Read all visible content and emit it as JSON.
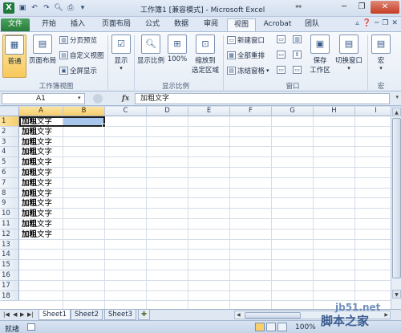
{
  "window": {
    "title": "工作簿1 [兼容模式] - Microsoft Excel",
    "app_icon_letter": "X",
    "qat_icons": [
      "save-icon",
      "undo-icon",
      "redo-icon",
      "print-preview-icon",
      "printer-icon",
      "customize-qat-icon"
    ],
    "resize_glyph": "⇔"
  },
  "tabs": [
    {
      "label": "文件",
      "id": "file"
    },
    {
      "label": "开始",
      "id": "home"
    },
    {
      "label": "插入",
      "id": "insert"
    },
    {
      "label": "页面布局",
      "id": "page-layout"
    },
    {
      "label": "公式",
      "id": "formulas"
    },
    {
      "label": "数据",
      "id": "data"
    },
    {
      "label": "审阅",
      "id": "review"
    },
    {
      "label": "视图",
      "id": "view",
      "active": true
    },
    {
      "label": "Acrobat",
      "id": "acrobat"
    },
    {
      "label": "团队",
      "id": "team"
    }
  ],
  "ribbon": {
    "workbook_views": {
      "label": "工作簿视图",
      "normal": "普通",
      "page_layout": "页面布局",
      "page_break_preview": "分页预览",
      "custom_views": "自定义视图",
      "full_screen": "全屏显示"
    },
    "show": {
      "label": "显示"
    },
    "zoom": {
      "label": "显示比例",
      "zoom": "显示比例",
      "hundred": "100%",
      "zoom_selection_1": "缩放到",
      "zoom_selection_2": "选定区域"
    },
    "window": {
      "label": "窗口",
      "new_window": "新建窗口",
      "arrange_all": "全部重排",
      "freeze_panes": "冻结窗格",
      "save_workspace_1": "保存",
      "save_workspace_2": "工作区",
      "switch_windows": "切换窗口"
    },
    "macros": {
      "label": "宏",
      "macros": "宏"
    }
  },
  "formula_bar": {
    "name_box": "A1",
    "fx": "fx",
    "content": "加粗文字"
  },
  "sheet": {
    "columns": [
      "A",
      "B",
      "C",
      "D",
      "E",
      "F",
      "G",
      "H",
      "I"
    ],
    "selected_columns": [
      "A",
      "B"
    ],
    "rows": [
      "1",
      "2",
      "3",
      "4",
      "5",
      "6",
      "7",
      "8",
      "9",
      "10",
      "11",
      "12",
      "13",
      "14",
      "15",
      "16",
      "17",
      "18"
    ],
    "selected_rows": [
      "1"
    ],
    "cells_a": [
      {
        "bold": "加粗",
        "plain": "文字"
      },
      {
        "bold": "加粗",
        "plain": "文字"
      },
      {
        "bold": "加粗",
        "plain": "文字"
      },
      {
        "bold": "加粗",
        "plain": "文字"
      },
      {
        "bold": "加粗",
        "plain": "文字"
      },
      {
        "bold": "加粗",
        "plain": "文字"
      },
      {
        "bold": "加粗",
        "plain": "文字"
      },
      {
        "bold": "加粗",
        "plain": "文字"
      },
      {
        "bold": "加粗",
        "plain": "文字"
      },
      {
        "bold": "加粗",
        "plain": "文字"
      },
      {
        "bold": "加粗",
        "plain": "文字"
      },
      {
        "bold": "加粗",
        "plain": "文字"
      }
    ],
    "selection": "A1:B1"
  },
  "sheet_tabs": [
    "Sheet1",
    "Sheet2",
    "Sheet3"
  ],
  "active_sheet": "Sheet1",
  "status": {
    "mode": "就绪",
    "zoom": "100%"
  },
  "watermark": {
    "line1": "jb51.net",
    "line2": "脚本之家"
  },
  "colors": {
    "accent": "#2a7b3b",
    "selection_fill": "#a8c5ec",
    "header_highlight": "#f6cd6c"
  }
}
